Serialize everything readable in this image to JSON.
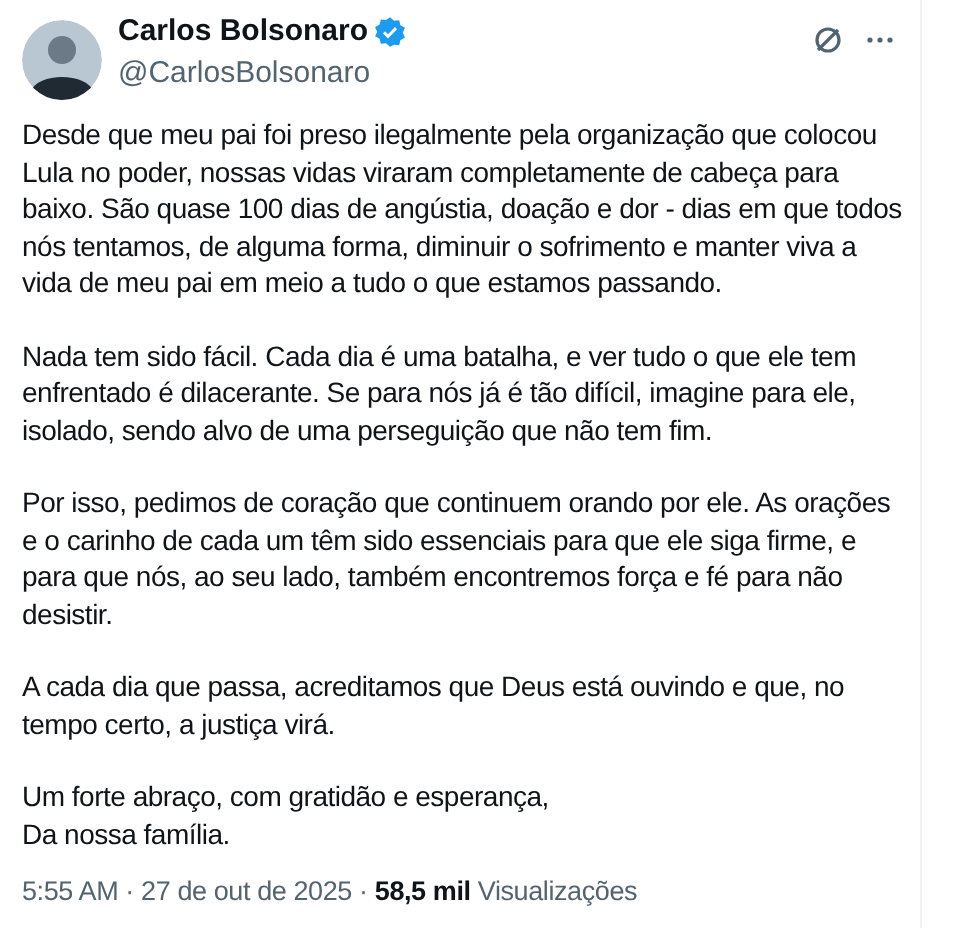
{
  "author": {
    "name": "Carlos Bolsonaro",
    "verified": true,
    "handle": "@CarlosBolsonaro"
  },
  "paragraphs": [
    "Desde que meu pai foi preso ilegalmente pela organização que colocou Lula no poder, nossas vidas viraram completamente de cabeça para baixo. São quase 100 dias de angústia, doação  e dor - dias em que todos nós tentamos, de alguma forma, diminuir o sofrimento e manter viva a vida de meu pai em meio a tudo o que estamos passando.",
    "Nada tem sido fácil. Cada dia é uma batalha, e ver tudo o que ele tem enfrentado é dilacerante. Se para nós já é tão difícil, imagine para ele, isolado, sendo alvo de uma perseguição que não tem fim.",
    "Por isso, pedimos de coração que continuem orando por ele. As orações e o carinho de cada um têm sido essenciais para que ele siga firme, e para que nós, ao seu lado, também encontremos força e fé para não desistir.",
    "A cada dia que passa, acreditamos que Deus está ouvindo e que, no tempo certo, a justiça virá.",
    "Um forte abraço, com gratidão e esperança,\nDa nossa família."
  ],
  "meta": "5:55 AM · 27 de out de 2025 · **58,5 mil** Visualizações"
}
